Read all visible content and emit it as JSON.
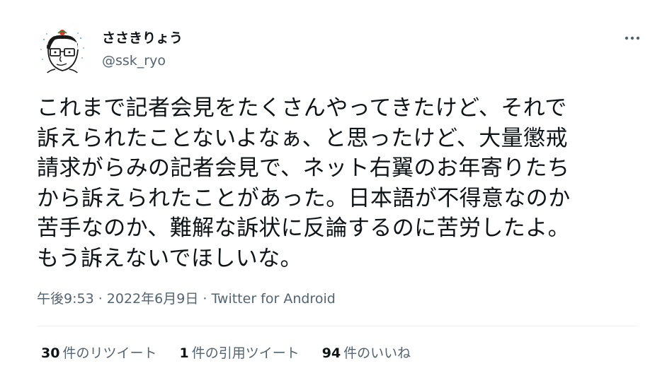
{
  "user": {
    "display_name": "ささきりょう",
    "handle": "@ssk_ryo"
  },
  "tweet": {
    "text": "これまで記者会見をたくさんやってきたけど、それで\n訴えられたことないよなぁ、と思ったけど、大量懲戒\n請求がらみの記者会見で、ネット右翼のお年寄りたち\nから訴えられたことがあった。日本語が不得意なのか\n苦手なのか、難解な訴状に反論するのに苦労したよ。\nもう訴えないでほしいな。",
    "time": "午後9:53",
    "separator": " · ",
    "date": "2022年6月9日",
    "source": "Twitter for Android"
  },
  "stats": {
    "retweets": {
      "count": "30",
      "label": "件のリツイート"
    },
    "quotes": {
      "count": "1",
      "label": "件の引用ツイート"
    },
    "likes": {
      "count": "94",
      "label": "件のいいね"
    }
  },
  "icons": {
    "more": "more-horizontal-icon",
    "avatar": "cartoon-face-with-glasses"
  },
  "colors": {
    "text": "#0f1419",
    "secondary": "#536471",
    "divider": "#eff3f4"
  }
}
